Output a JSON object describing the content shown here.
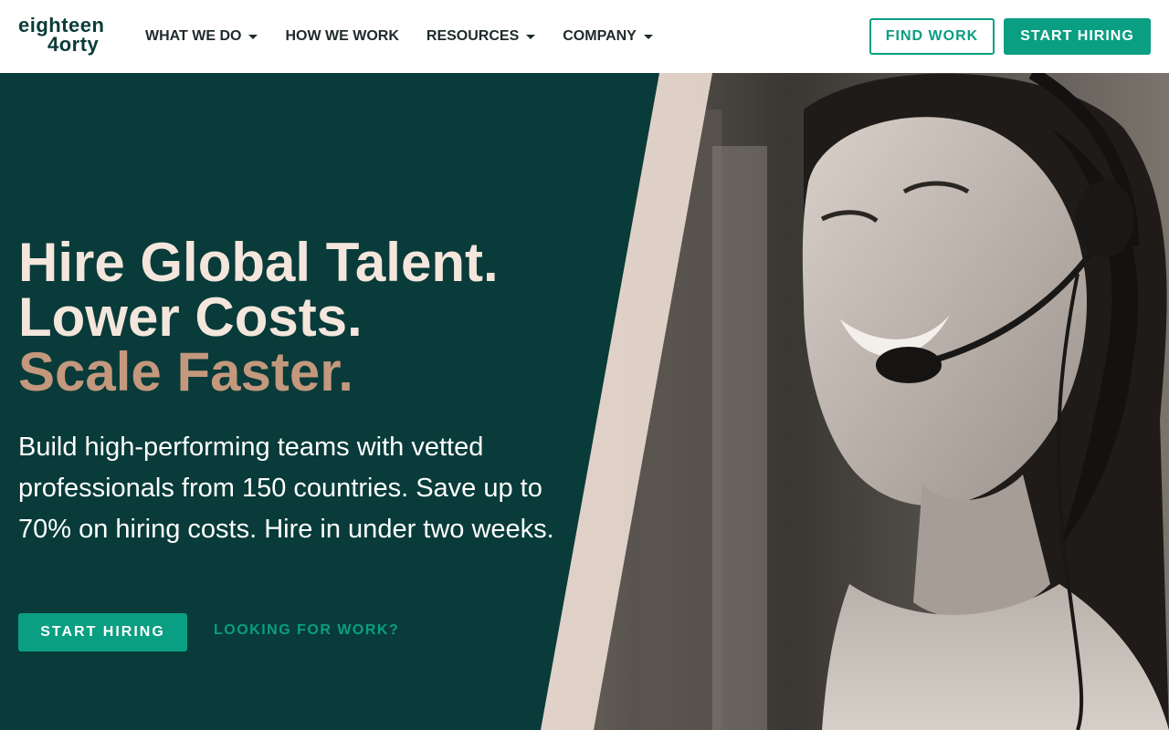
{
  "brand": {
    "logo_line1": "eighteen",
    "logo_line2": "4orty"
  },
  "nav": {
    "items": [
      {
        "label": "WHAT WE DO",
        "has_dropdown": true
      },
      {
        "label": "HOW WE WORK",
        "has_dropdown": false
      },
      {
        "label": "RESOURCES",
        "has_dropdown": true
      },
      {
        "label": "COMPANY",
        "has_dropdown": true
      }
    ],
    "find_work_label": "FIND WORK",
    "start_hiring_label": "START HIRING"
  },
  "hero": {
    "headline_line1": "Hire Global Talent.",
    "headline_line2": "Lower Costs.",
    "headline_line3": "Scale Faster.",
    "subtext": "Build high-performing teams with vetted professionals from 150 countries. Save up to 70% on hiring costs. Hire in under two weeks.",
    "cta_label": "START HIRING",
    "secondary_link": "LOOKING FOR WORK?",
    "image_subject": "smiling woman wearing call-center headset"
  },
  "colors": {
    "hero_bg": "#083b39",
    "accent": "#0a9e82",
    "headline_light": "#f4e6dc",
    "headline_warm": "#c4987d",
    "nav_text": "#1f2a2a"
  }
}
